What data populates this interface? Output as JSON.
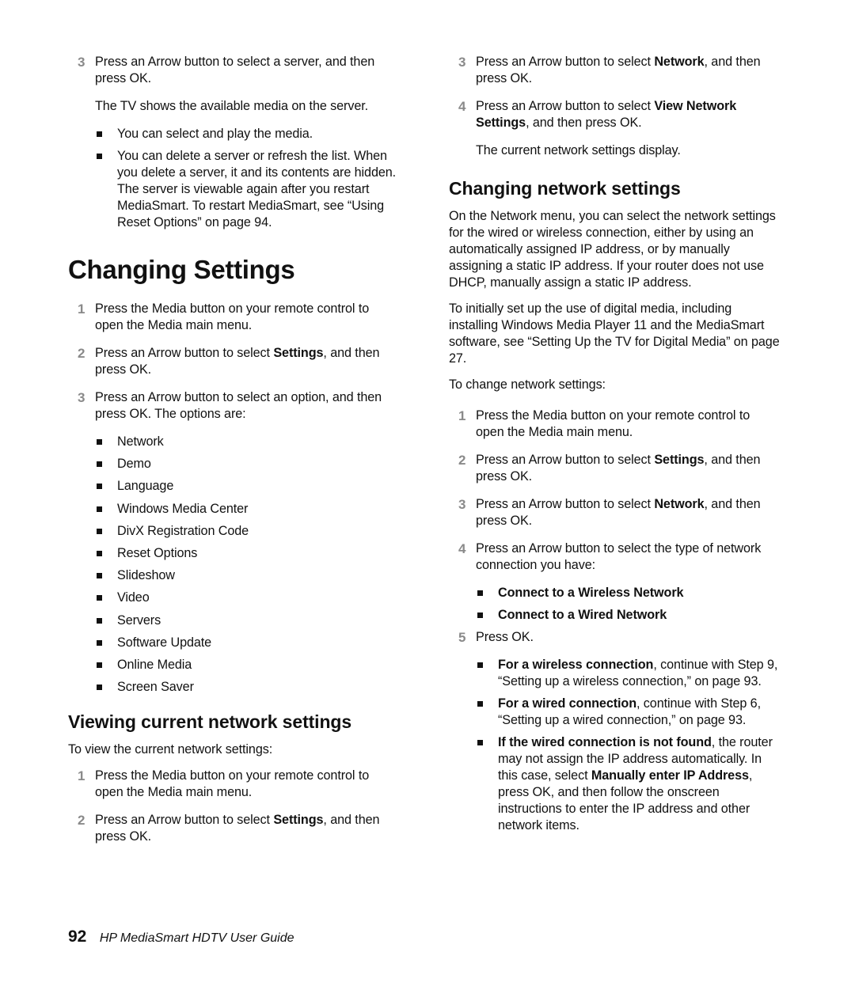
{
  "left": {
    "top_step": {
      "num": "3",
      "text": "Press an Arrow button to select a server, and then press OK."
    },
    "top_note": "The TV shows the available media on the server.",
    "top_bullets": [
      "You can select and play the media.",
      "You can delete a server or refresh the list. When you delete a server, it and its contents are hidden. The server is viewable again after you restart MediaSmart. To restart MediaSmart, see “Using Reset Options” on page 94."
    ],
    "heading": "Changing Settings",
    "steps": [
      {
        "num": "1",
        "text": "Press the Media button on your remote control to open the Media main menu."
      },
      {
        "num": "2",
        "pre": "Press an Arrow button to select ",
        "bold": "Settings",
        "post": ", and then press OK."
      },
      {
        "num": "3",
        "text": "Press an Arrow button to select an option, and then press OK. The options are:"
      }
    ],
    "options": [
      "Network",
      "Demo",
      "Language",
      "Windows Media Center",
      "DivX Registration Code",
      "Reset Options",
      "Slideshow",
      "Video",
      "Servers",
      "Software Update",
      "Online Media",
      "Screen Saver"
    ],
    "subheading": "Viewing current network settings",
    "intro": "To view the current network settings:",
    "view_steps": [
      {
        "num": "1",
        "text": "Press the Media button on your remote control to open the Media main menu."
      },
      {
        "num": "2",
        "pre": "Press an Arrow button to select ",
        "bold": "Settings",
        "post": ", and then press OK."
      }
    ]
  },
  "right": {
    "top_steps": [
      {
        "num": "3",
        "pre": "Press an Arrow button to select ",
        "bold": "Network",
        "post": ", and then press OK."
      },
      {
        "num": "4",
        "pre": "Press an Arrow button to select ",
        "bold": "View Network Settings",
        "post": ", and then press OK."
      }
    ],
    "top_note": "The current network settings display.",
    "heading": "Changing network settings",
    "para1": "On the Network menu, you can select the network settings for the wired or wireless connection, either by using an automatically assigned IP address, or by manually assigning a static IP address. If your router does not use DHCP, manually assign a static IP address.",
    "para2": "To initially set up the use of digital media, including installing Windows Media Player 11 and the MediaSmart software, see “Setting Up the TV for Digital Media” on page 27.",
    "para3": "To change network settings:",
    "steps": [
      {
        "num": "1",
        "text": "Press the Media button on your remote control to open the Media main menu."
      },
      {
        "num": "2",
        "pre": "Press an Arrow button to select ",
        "bold": "Settings",
        "post": ", and then press OK."
      },
      {
        "num": "3",
        "pre": "Press an Arrow button to select ",
        "bold": "Network",
        "post": ", and then press OK."
      },
      {
        "num": "4",
        "text": "Press an Arrow button to select the type of network connection you have:"
      }
    ],
    "connection_types": [
      "Connect to a Wireless Network",
      "Connect to a Wired Network"
    ],
    "step5": {
      "num": "5",
      "text": "Press OK."
    },
    "outcomes": [
      {
        "bold": "For a wireless connection",
        "text": ", continue with Step 9, “Setting up a wireless connection,” on page 93."
      },
      {
        "bold": "For a wired connection",
        "text": ", continue with Step 6, “Setting up a wired connection,” on page 93."
      },
      {
        "bold": "If the wired connection is not found",
        "text": ", the router may not assign the IP address automatically. In this case, select ",
        "bold2": "Manually enter IP Address",
        "text2": ", press OK, and then follow the onscreen instructions to enter the IP address and other network items."
      }
    ]
  },
  "footer": {
    "page_number": "92",
    "title": "HP MediaSmart HDTV User Guide"
  }
}
